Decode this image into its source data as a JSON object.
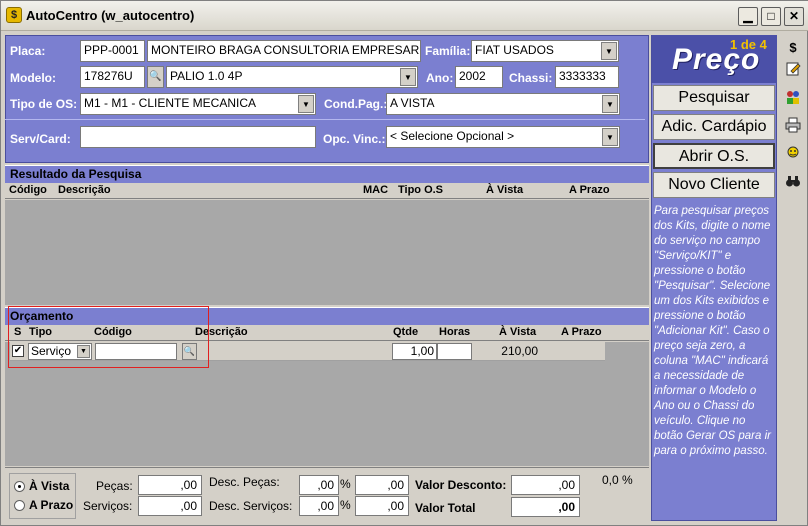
{
  "window": {
    "title": "AutoCentro (w_autocentro)",
    "icon": "app-icon",
    "minimize_label": "▁",
    "maximize_label": "□",
    "close_label": "✕"
  },
  "form": {
    "placa_label": "Placa:",
    "placa_value": "PPP-0001",
    "cliente_value": "MONTEIRO BRAGA CONSULTORIA EMPRESAR",
    "familia_label": "Família:",
    "familia_value": "FIAT USADOS",
    "modelo_label": "Modelo:",
    "modelo_code": "178276U",
    "modelo_value": "PALIO 1.0 4P",
    "ano_label": "Ano:",
    "ano_value": "2002",
    "chassi_label": "Chassi:",
    "chassi_value": "3333333",
    "tipo_os_label": "Tipo de OS:",
    "tipo_os_value": "M1 - M1 - CLIENTE MECANICA",
    "cond_pag_label": "Cond.Pag.:",
    "cond_pag_value": "A VISTA",
    "serv_card_label": "Serv/Card:",
    "serv_card_value": "",
    "opc_vinc_label": "Opc. Vinc.:",
    "opc_vinc_value": "< Selecione Opcional >"
  },
  "resultado": {
    "title": "Resultado da Pesquisa",
    "columns": [
      "Código",
      "Descrição",
      "MAC",
      "Tipo O.S",
      "À Vista",
      "A Prazo"
    ]
  },
  "orcamento": {
    "title": "Orçamento",
    "columns": [
      "S",
      "Tipo",
      "Código",
      "Descrição",
      "Qtde",
      "Horas",
      "À Vista",
      "A Prazo"
    ],
    "row": {
      "checked": "✔",
      "tipo": "Serviço",
      "codigo": "",
      "descricao": "",
      "qtde": "1,00",
      "horas": "",
      "a_vista": "210,00",
      "a_prazo": ""
    }
  },
  "right_panel": {
    "logo_text": "Preço",
    "page_indicator": "1 de 4",
    "pesquisar_label": "Pesquisar",
    "adic_cardapio_label": "Adic. Cardápio",
    "abrir_os_label": "Abrir O.S.",
    "novo_cliente_label": "Novo Cliente",
    "help_text": "Para pesquisar preços dos Kits, digite o nome do serviço no campo \"Serviço/KIT\" e pressione o botão \"Pesquisar\". Selecione um dos Kits exibidos e pressione o botão \"Adicionar Kit\". Caso o preço seja zero, a coluna \"MAC\" indicará a necessidade de informar o Modelo o Ano ou o Chassi do veículo. Clique no botão Gerar OS para ir para o próximo passo."
  },
  "toolbar": {
    "icons": [
      "dollar-icon",
      "edit-icon",
      "users-icon",
      "print-icon",
      "search-user-icon",
      "binoculars-icon"
    ],
    "dollar": "$"
  },
  "footer": {
    "a_vista_label": "À Vista",
    "a_prazo_label": "A Prazo",
    "pecas_label": "Peças:",
    "pecas_value": ",00",
    "servicos_label": "Serviços:",
    "servicos_value": ",00",
    "desc_pecas_label": "Desc. Peças:",
    "desc_pecas_pct": ",00",
    "desc_pecas_value": ",00",
    "desc_servicos_label": "Desc. Serviços:",
    "desc_servicos_pct": ",00",
    "desc_servicos_value": ",00",
    "pct_symbol": "%",
    "valor_desconto_label": "Valor Desconto:",
    "valor_desconto_value": ",00",
    "valor_total_label": "Valor Total",
    "valor_total_value": ",00",
    "desconto_pct": "0,0 %"
  }
}
